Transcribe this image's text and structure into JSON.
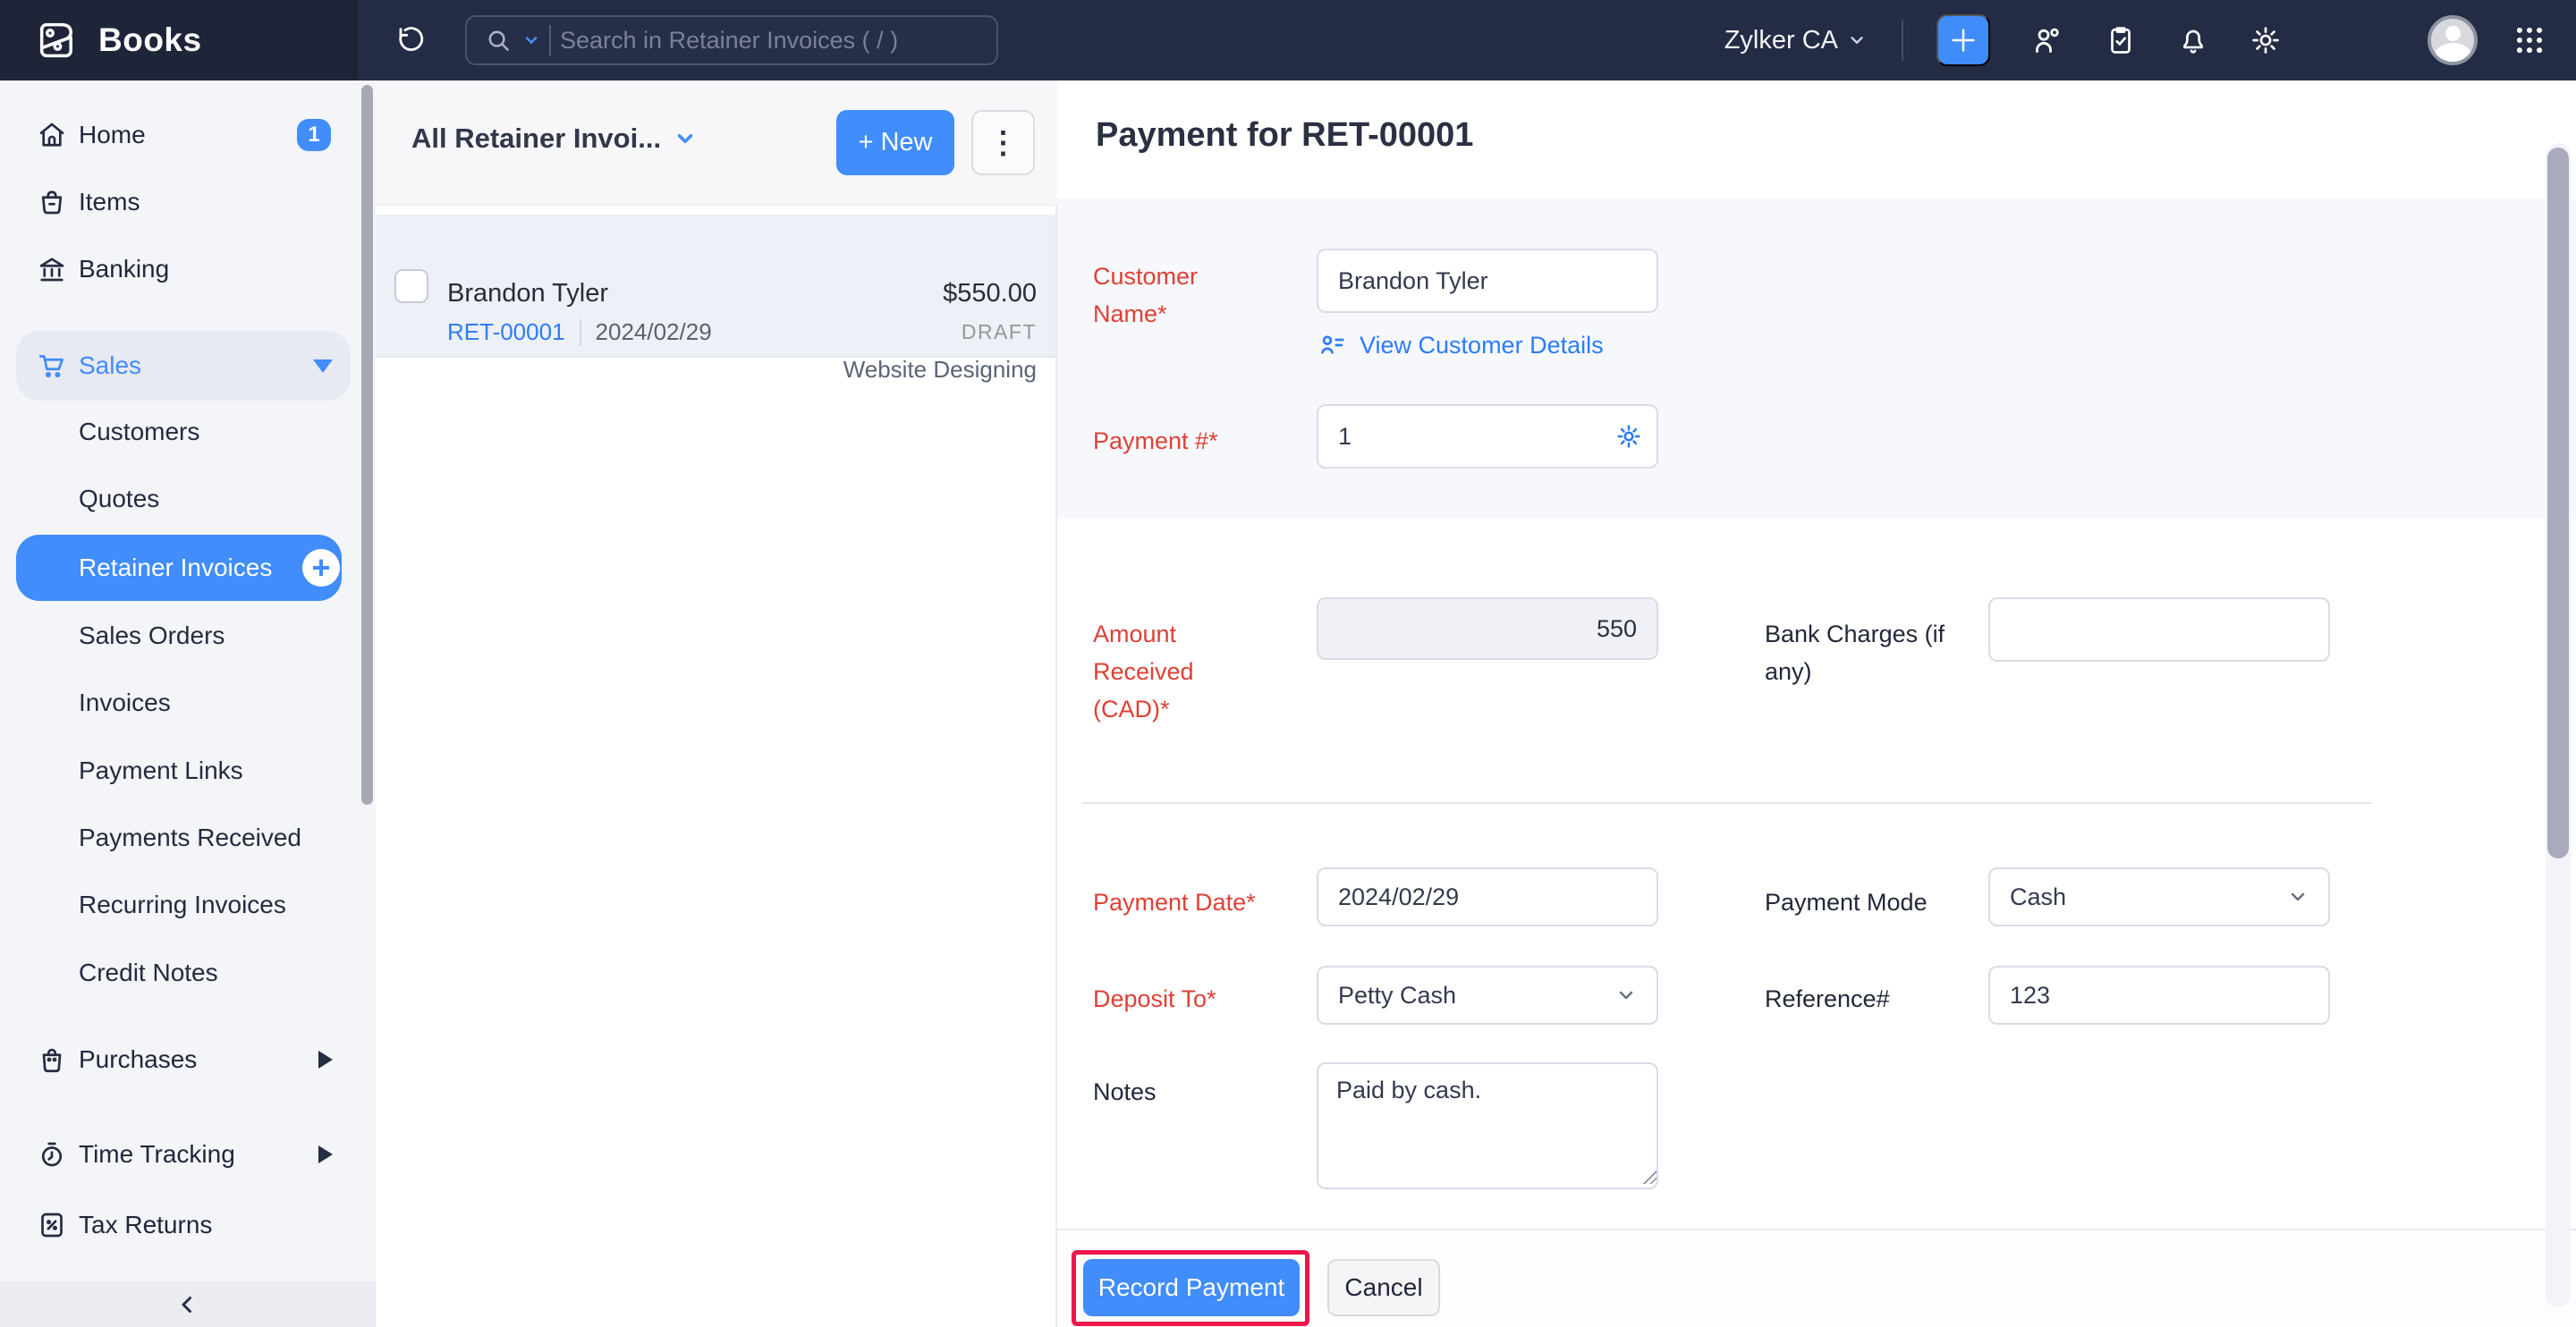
{
  "topbar": {
    "app_name": "Books",
    "search_placeholder": "Search in Retainer Invoices ( / )",
    "org_name": "Zylker CA"
  },
  "sidebar": {
    "items": [
      {
        "label": "Home",
        "badge": "1"
      },
      {
        "label": "Items"
      },
      {
        "label": "Banking"
      },
      {
        "label": "Sales"
      },
      {
        "label": "Purchases"
      },
      {
        "label": "Time Tracking"
      },
      {
        "label": "Tax Returns"
      }
    ],
    "sales_children": [
      {
        "label": "Customers"
      },
      {
        "label": "Quotes"
      },
      {
        "label": "Retainer Invoices"
      },
      {
        "label": "Sales Orders"
      },
      {
        "label": "Invoices"
      },
      {
        "label": "Payment Links"
      },
      {
        "label": "Payments Received"
      },
      {
        "label": "Recurring Invoices"
      },
      {
        "label": "Credit Notes"
      }
    ]
  },
  "list_panel": {
    "title": "All Retainer Invoi...",
    "new_button": "+ New",
    "item": {
      "customer": "Brandon Tyler",
      "amount": "$550.00",
      "number": "RET-00001",
      "date": "2024/02/29",
      "status": "DRAFT",
      "project": "Website Designing"
    }
  },
  "main": {
    "heading": "Payment for RET-00001",
    "fields": {
      "customer_name": {
        "label": "Customer Name*",
        "value": "Brandon Tyler",
        "link": "View Customer Details"
      },
      "payment_number": {
        "label": "Payment #*",
        "value": "1"
      },
      "amount_received": {
        "label": "Amount Received (CAD)*",
        "value": "550"
      },
      "bank_charges": {
        "label": "Bank Charges (if any)",
        "value": ""
      },
      "payment_date": {
        "label": "Payment Date*",
        "value": "2024/02/29"
      },
      "payment_mode": {
        "label": "Payment Mode",
        "value": "Cash"
      },
      "deposit_to": {
        "label": "Deposit To*",
        "value": "Petty Cash"
      },
      "reference": {
        "label": "Reference#",
        "value": "123"
      },
      "notes": {
        "label": "Notes",
        "value": "Paid by cash."
      }
    },
    "buttons": {
      "record": "Record Payment",
      "cancel": "Cancel"
    }
  },
  "colors": {
    "accent": "#408dfb",
    "required_label": "#de4035",
    "draft_status": "#8f9b97",
    "annotation": "#ec174b",
    "topbar": "#242b44"
  }
}
